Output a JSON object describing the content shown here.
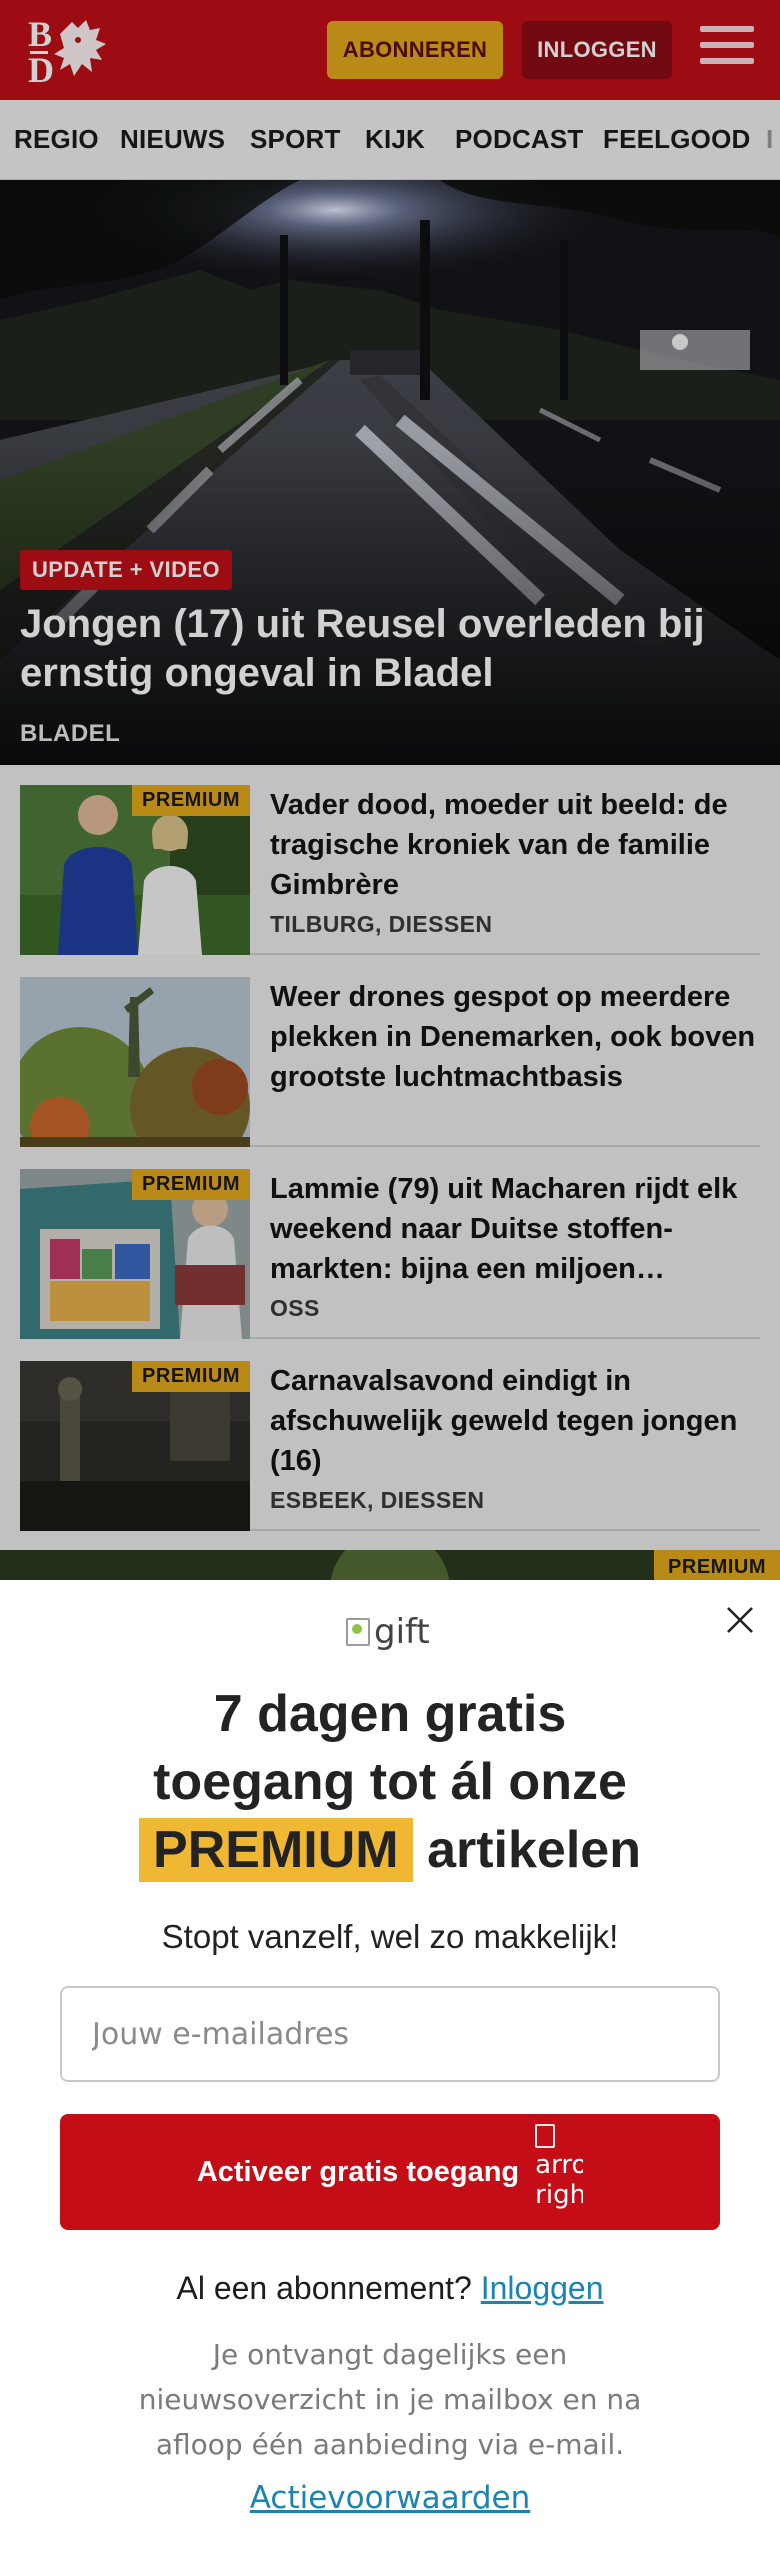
{
  "header": {
    "logo_alt": "BD",
    "subscribe_label": "ABONNEREN",
    "login_label": "INLOGGEN",
    "colors": {
      "brand_red": "#c10f18",
      "subscribe_gold": "#e3a91c",
      "login_dark_red": "#8c0c14"
    }
  },
  "nav": {
    "items": [
      "REGIO",
      "NIEUWS",
      "SPORT",
      "KIJK",
      "PODCAST",
      "FEELGOOD",
      "I"
    ]
  },
  "hero": {
    "badge": "UPDATE + VIDEO",
    "title": "Jongen (17) uit Reusel overleden bij ernstig ongeval in Bladel",
    "location": "BLADEL"
  },
  "articles": [
    {
      "title": "Vader dood, moeder uit beeld: de tragische kroniek van de familie Gimbrère",
      "location": "TILBURG, DIESSEN",
      "premium": "PREMIUM"
    },
    {
      "title": "Weer drones gespot op meerdere plekken in Denemarken, ook boven grootste luchtmachtbasis",
      "location": "",
      "premium": ""
    },
    {
      "title": "Lammie (79) uit Macharen rijdt elk weekend naar Duitse stoffen-markten: bijna een miljoen…",
      "location": "OSS",
      "premium": "PREMIUM"
    },
    {
      "title": "Carnavalsavond eindigt in afschuwelijk geweld tegen jongen (16)",
      "location": "ESBEEK, DIESSEN",
      "premium": "PREMIUM"
    }
  ],
  "next_item": {
    "premium": "PREMIUM"
  },
  "paywall": {
    "gift_alt": "gift",
    "headline_line1": "7 dagen gratis",
    "headline_line2": "toegang tot ál onze",
    "headline_highlight": "PREMIUM",
    "headline_tail": "artikelen",
    "subline": "Stopt vanzelf, wel zo makkelijk!",
    "email_placeholder": "Jouw e-mailadres",
    "email_value": "",
    "cta_label": "Activeer gratis toegang",
    "cta_arrow_alt_1": "arro",
    "cta_arrow_alt_2": "righ",
    "already_text": "Al een abonnement?",
    "already_link": "Inloggen",
    "note": "Je ontvangt dagelijks een nieuwsoverzicht in je mailbox en na afloop één aanbieding via e-mail.",
    "terms_link": "Actievoorwaarden",
    "colors": {
      "cta_red": "#c40d17",
      "highlight_gold": "#f0b832",
      "link_blue": "#1b84b5"
    }
  }
}
